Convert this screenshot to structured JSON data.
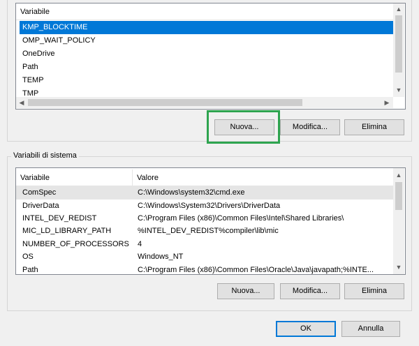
{
  "user_vars": {
    "header": "Variabile",
    "rows": [
      "KMP_BLOCKTIME",
      "OMP_WAIT_POLICY",
      "OneDrive",
      "Path",
      "TEMP",
      "TMP"
    ],
    "buttons": {
      "new": "Nuova...",
      "edit": "Modifica...",
      "delete": "Elimina"
    }
  },
  "system_vars": {
    "group_label": "Variabili di sistema",
    "header_name": "Variabile",
    "header_value": "Valore",
    "rows": [
      {
        "name": "ComSpec",
        "value": "C:\\Windows\\system32\\cmd.exe"
      },
      {
        "name": "DriverData",
        "value": "C:\\Windows\\System32\\Drivers\\DriverData"
      },
      {
        "name": "INTEL_DEV_REDIST",
        "value": "C:\\Program Files (x86)\\Common Files\\Intel\\Shared Libraries\\"
      },
      {
        "name": "MIC_LD_LIBRARY_PATH",
        "value": "%INTEL_DEV_REDIST%compiler\\lib\\mic"
      },
      {
        "name": "NUMBER_OF_PROCESSORS",
        "value": "4"
      },
      {
        "name": "OS",
        "value": "Windows_NT"
      },
      {
        "name": "Path",
        "value": "C:\\Program Files (x86)\\Common Files\\Oracle\\Java\\javapath;%INTE..."
      }
    ],
    "buttons": {
      "new": "Nuova...",
      "edit": "Modifica...",
      "delete": "Elimina"
    }
  },
  "dialog": {
    "ok": "OK",
    "cancel": "Annulla"
  },
  "colors": {
    "selection": "#0078d7",
    "highlight_box": "#2ea44f"
  },
  "icons": {
    "up": "▲",
    "down": "▼",
    "left": "◀",
    "right": "▶"
  }
}
